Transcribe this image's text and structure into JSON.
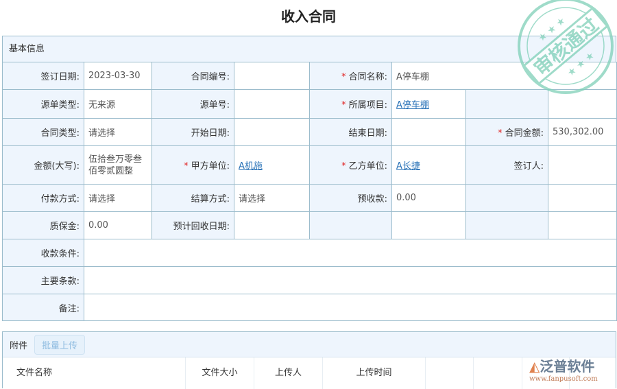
{
  "title": "收入合同",
  "section_basic": "基本信息",
  "fields": {
    "sign_date": {
      "label": "签订日期:",
      "value": "2023-03-30"
    },
    "contract_no": {
      "label": "合同编号:",
      "value": ""
    },
    "contract_name": {
      "label": "合同名称:",
      "value": "A停车棚"
    },
    "source_type": {
      "label": "源单类型:",
      "value": "无来源"
    },
    "source_no": {
      "label": "源单号:",
      "value": ""
    },
    "project": {
      "label": "所属项目:",
      "value": "A停车棚"
    },
    "contract_type": {
      "label": "合同类型:",
      "value": "请选择"
    },
    "start_date": {
      "label": "开始日期:",
      "value": ""
    },
    "end_date": {
      "label": "结束日期:",
      "value": ""
    },
    "amount": {
      "label": "合同金额:",
      "value": "530,302.00"
    },
    "amount_upper": {
      "label": "金额(大写):",
      "value": "伍拾叁万零叁佰零贰圆整"
    },
    "party_a": {
      "label": "甲方单位:",
      "value": "A机施"
    },
    "party_b": {
      "label": "乙方单位:",
      "value": "A长捷"
    },
    "signer": {
      "label": "签订人:",
      "value": ""
    },
    "payment": {
      "label": "付款方式:",
      "value": "请选择"
    },
    "settlement": {
      "label": "结算方式:",
      "value": "请选择"
    },
    "advance": {
      "label": "预收款:",
      "value": "0.00"
    },
    "warranty": {
      "label": "质保金:",
      "value": "0.00"
    },
    "expected_date": {
      "label": "预计回收日期:",
      "value": ""
    },
    "terms_receipt": {
      "label": "收款条件:",
      "value": ""
    },
    "main_terms": {
      "label": "主要条款:",
      "value": ""
    },
    "remark": {
      "label": "备注:",
      "value": ""
    }
  },
  "required_mark": "*",
  "attachments": {
    "label": "附件",
    "upload_button": "批量上传",
    "columns": [
      "文件名称",
      "文件大小",
      "上传人",
      "上传时间"
    ]
  },
  "stamp": {
    "text": "审核通过"
  },
  "logo": {
    "name": "泛普软件",
    "url": "www.fanpusoft.com"
  }
}
